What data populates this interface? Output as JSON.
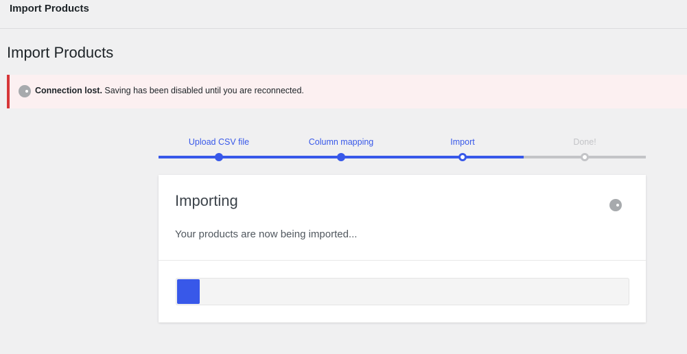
{
  "topbar": {
    "title": "Import Products"
  },
  "page": {
    "title": "Import Products"
  },
  "notice": {
    "strong": "Connection lost.",
    "message": " Saving has been disabled until you are reconnected.",
    "icon": "spinner-icon",
    "color": "#d63638"
  },
  "steps": [
    {
      "label": "Upload CSV file",
      "state": "done"
    },
    {
      "label": "Column mapping",
      "state": "done"
    },
    {
      "label": "Import",
      "state": "active"
    },
    {
      "label": "Done!",
      "state": "future"
    }
  ],
  "card": {
    "title": "Importing",
    "text": "Your products are now being imported...",
    "progress_fraction": 0.05
  },
  "colors": {
    "accent": "#3858e9",
    "inactive": "#c3c4c7"
  }
}
